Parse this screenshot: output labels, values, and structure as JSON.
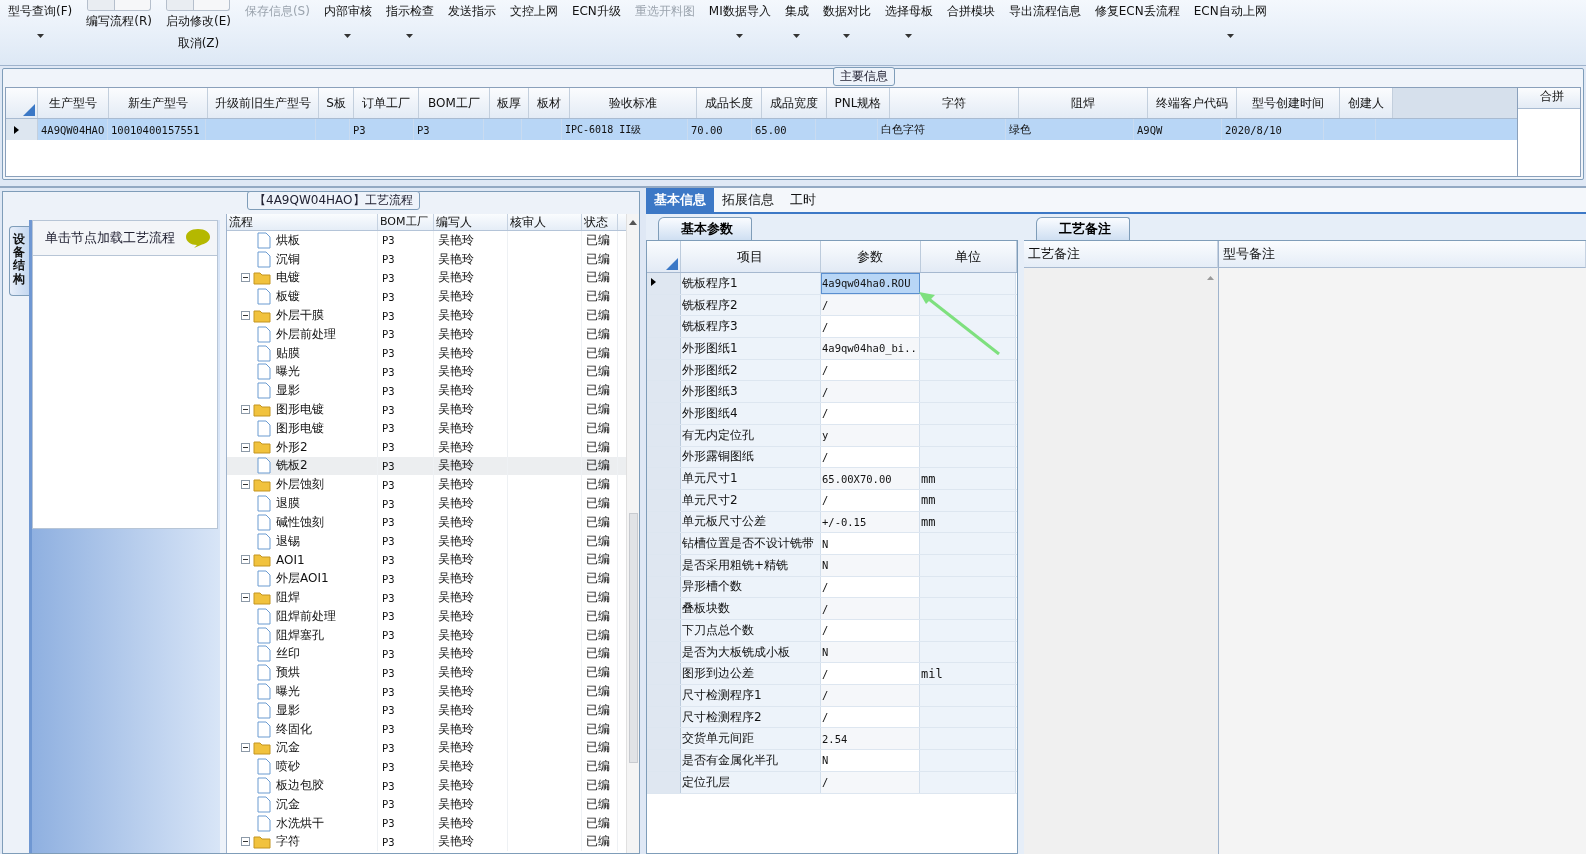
{
  "toolbar": [
    {
      "label": "型号查询(F)",
      "kind": "dropdown",
      "disabled": false
    },
    {
      "label": "编写流程(R)",
      "kind": "toggle",
      "on": false,
      "disabled": false
    },
    {
      "label": "启动修改(E)",
      "kind": "toggle",
      "on": false,
      "second_label": "取消(Z)",
      "disabled": false
    },
    {
      "label": "保存信息(S)",
      "kind": "plain",
      "disabled": true
    },
    {
      "label": "内部审核",
      "kind": "dropdown",
      "disabled": false
    },
    {
      "label": "指示检查",
      "kind": "dropdown",
      "disabled": false
    },
    {
      "label": "发送指示",
      "kind": "plain",
      "disabled": false
    },
    {
      "label": "文控上网",
      "kind": "plain",
      "disabled": false
    },
    {
      "label": "ECN升级",
      "kind": "plain",
      "disabled": false
    },
    {
      "label": "重选开料图",
      "kind": "plain",
      "disabled": true
    },
    {
      "label": "MI数据导入",
      "kind": "dropdown",
      "disabled": false
    },
    {
      "label": "集成",
      "kind": "dropdown",
      "disabled": false
    },
    {
      "label": "数据对比",
      "kind": "dropdown",
      "disabled": false
    },
    {
      "label": "选择母板",
      "kind": "dropdown",
      "disabled": false
    },
    {
      "label": "合拼模块",
      "kind": "plain",
      "disabled": false
    },
    {
      "label": "导出流程信息",
      "kind": "plain",
      "disabled": false
    },
    {
      "label": "修复ECN丢流程",
      "kind": "plain",
      "disabled": false
    },
    {
      "label": "ECN自动上网",
      "kind": "dropdown",
      "disabled": false
    }
  ],
  "main_info": {
    "title": "主要信息",
    "columns": [
      "生产型号",
      "新生产型号",
      "升级前旧生产型号",
      "S板",
      "订单工厂",
      "BOM工厂",
      "板厚",
      "板材",
      "验收标准",
      "成品长度",
      "成品宽度",
      "PNL规格",
      "字符",
      "阻焊",
      "终端客户代码",
      "型号创建时间",
      "创建人"
    ],
    "rows": [
      {
        "selected": true,
        "cells": [
          "4A9QW04HAO",
          "10010400157551",
          "",
          "",
          "P3",
          "P3",
          "",
          "",
          "IPC-6018 II级",
          "70.00",
          "65.00",
          "",
          "白色字符",
          "绿色",
          "A9QW",
          "2020/8/10",
          ""
        ]
      }
    ],
    "side_header": "合拼"
  },
  "flow": {
    "title": "【4A9QW04HAO】工艺流程",
    "side_tab": "设备结构",
    "hint": "单击节点加载工艺流程",
    "columns": [
      "流程",
      "BOM工厂",
      "编写人",
      "核审人",
      "状态"
    ],
    "nodes": [
      {
        "kind": "file",
        "label": "烘板",
        "bom": "P3",
        "writer": "吴艳玲",
        "status": "已编",
        "selected": false
      },
      {
        "kind": "file",
        "label": "沉铜",
        "bom": "P3",
        "writer": "吴艳玲",
        "status": "已编",
        "selected": false
      },
      {
        "kind": "folder",
        "label": "电镀",
        "bom": "P3",
        "writer": "吴艳玲",
        "status": "已编",
        "selected": false,
        "expanded": true,
        "children": [
          {
            "kind": "file",
            "label": "板镀",
            "bom": "P3",
            "writer": "吴艳玲",
            "status": "已编",
            "selected": false
          }
        ]
      },
      {
        "kind": "folder",
        "label": "外层干膜",
        "bom": "P3",
        "writer": "吴艳玲",
        "status": "已编",
        "selected": false,
        "expanded": true,
        "children": [
          {
            "kind": "file",
            "label": "外层前处理",
            "bom": "P3",
            "writer": "吴艳玲",
            "status": "已编",
            "selected": false
          },
          {
            "kind": "file",
            "label": "贴膜",
            "bom": "P3",
            "writer": "吴艳玲",
            "status": "已编",
            "selected": false
          },
          {
            "kind": "file",
            "label": "曝光",
            "bom": "P3",
            "writer": "吴艳玲",
            "status": "已编",
            "selected": false
          },
          {
            "kind": "file",
            "label": "显影",
            "bom": "P3",
            "writer": "吴艳玲",
            "status": "已编",
            "selected": false
          }
        ]
      },
      {
        "kind": "folder",
        "label": "图形电镀",
        "bom": "P3",
        "writer": "吴艳玲",
        "status": "已编",
        "selected": false,
        "expanded": true,
        "children": [
          {
            "kind": "file",
            "label": "图形电镀",
            "bom": "P3",
            "writer": "吴艳玲",
            "status": "已编",
            "selected": false
          }
        ]
      },
      {
        "kind": "folder",
        "label": "外形2",
        "bom": "P3",
        "writer": "吴艳玲",
        "status": "已编",
        "selected": false,
        "expanded": true,
        "children": [
          {
            "kind": "file",
            "label": "铣板2",
            "bom": "P3",
            "writer": "吴艳玲",
            "status": "已编",
            "selected": true
          }
        ]
      },
      {
        "kind": "folder",
        "label": "外层蚀刻",
        "bom": "P3",
        "writer": "吴艳玲",
        "status": "已编",
        "selected": false,
        "expanded": true,
        "children": [
          {
            "kind": "file",
            "label": "退膜",
            "bom": "P3",
            "writer": "吴艳玲",
            "status": "已编",
            "selected": false
          },
          {
            "kind": "file",
            "label": "碱性蚀刻",
            "bom": "P3",
            "writer": "吴艳玲",
            "status": "已编",
            "selected": false
          },
          {
            "kind": "file",
            "label": "退锡",
            "bom": "P3",
            "writer": "吴艳玲",
            "status": "已编",
            "selected": false
          }
        ]
      },
      {
        "kind": "folder",
        "label": "AOI1",
        "bom": "P3",
        "writer": "吴艳玲",
        "status": "已编",
        "selected": false,
        "expanded": true,
        "children": [
          {
            "kind": "file",
            "label": "外层AOI1",
            "bom": "P3",
            "writer": "吴艳玲",
            "status": "已编",
            "selected": false
          }
        ]
      },
      {
        "kind": "folder",
        "label": "阻焊",
        "bom": "P3",
        "writer": "吴艳玲",
        "status": "已编",
        "selected": false,
        "expanded": true,
        "children": [
          {
            "kind": "file",
            "label": "阻焊前处理",
            "bom": "P3",
            "writer": "吴艳玲",
            "status": "已编",
            "selected": false
          },
          {
            "kind": "file",
            "label": "阻焊塞孔",
            "bom": "P3",
            "writer": "吴艳玲",
            "status": "已编",
            "selected": false
          },
          {
            "kind": "file",
            "label": "丝印",
            "bom": "P3",
            "writer": "吴艳玲",
            "status": "已编",
            "selected": false
          },
          {
            "kind": "file",
            "label": "预烘",
            "bom": "P3",
            "writer": "吴艳玲",
            "status": "已编",
            "selected": false
          },
          {
            "kind": "file",
            "label": "曝光",
            "bom": "P3",
            "writer": "吴艳玲",
            "status": "已编",
            "selected": false
          },
          {
            "kind": "file",
            "label": "显影",
            "bom": "P3",
            "writer": "吴艳玲",
            "status": "已编",
            "selected": false
          },
          {
            "kind": "file",
            "label": "终固化",
            "bom": "P3",
            "writer": "吴艳玲",
            "status": "已编",
            "selected": false
          }
        ]
      },
      {
        "kind": "folder",
        "label": "沉金",
        "bom": "P3",
        "writer": "吴艳玲",
        "status": "已编",
        "selected": false,
        "expanded": true,
        "children": [
          {
            "kind": "file",
            "label": "喷砂",
            "bom": "P3",
            "writer": "吴艳玲",
            "status": "已编",
            "selected": false
          },
          {
            "kind": "file",
            "label": "板边包胶",
            "bom": "P3",
            "writer": "吴艳玲",
            "status": "已编",
            "selected": false
          },
          {
            "kind": "file",
            "label": "沉金",
            "bom": "P3",
            "writer": "吴艳玲",
            "status": "已编",
            "selected": false
          },
          {
            "kind": "file",
            "label": "水洗烘干",
            "bom": "P3",
            "writer": "吴艳玲",
            "status": "已编",
            "selected": false
          }
        ]
      },
      {
        "kind": "folder",
        "label": "字符",
        "bom": "P3",
        "writer": "吴艳玲",
        "status": "已编",
        "selected": false,
        "expanded": true
      }
    ]
  },
  "tabs": [
    {
      "label": "基本信息",
      "selected": true
    },
    {
      "label": "拓展信息",
      "selected": false
    },
    {
      "label": "工时",
      "selected": false
    }
  ],
  "params": {
    "tab": "基本参数",
    "columns": [
      "项目",
      "参数",
      "单位"
    ],
    "rows": [
      {
        "item": "铣板程序1",
        "value": "4a9qw04ha0.ROU",
        "unit": "",
        "selected": true
      },
      {
        "item": "铣板程序2",
        "value": "/",
        "unit": "",
        "selected": false
      },
      {
        "item": "铣板程序3",
        "value": "/",
        "unit": "",
        "selected": false
      },
      {
        "item": "外形图纸1",
        "value": "4a9qw04ha0_bi...",
        "unit": "",
        "selected": false
      },
      {
        "item": "外形图纸2",
        "value": "/",
        "unit": "",
        "selected": false
      },
      {
        "item": "外形图纸3",
        "value": "/",
        "unit": "",
        "selected": false
      },
      {
        "item": "外形图纸4",
        "value": "/",
        "unit": "",
        "selected": false
      },
      {
        "item": "有无内定位孔",
        "value": "y",
        "unit": "",
        "selected": false
      },
      {
        "item": "外形露铜图纸",
        "value": "/",
        "unit": "",
        "selected": false
      },
      {
        "item": "单元尺寸1",
        "value": "65.00X70.00",
        "unit": "mm",
        "selected": false
      },
      {
        "item": "单元尺寸2",
        "value": "/",
        "unit": "mm",
        "selected": false
      },
      {
        "item": "单元板尺寸公差",
        "value": "+/-0.15",
        "unit": "mm",
        "selected": false
      },
      {
        "item": "钻槽位置是否不设计铣带",
        "value": "N",
        "unit": "",
        "selected": false
      },
      {
        "item": "是否采用粗铣+精铣",
        "value": "N",
        "unit": "",
        "selected": false
      },
      {
        "item": "异形槽个数",
        "value": "/",
        "unit": "",
        "selected": false
      },
      {
        "item": "叠板块数",
        "value": "/",
        "unit": "",
        "selected": false
      },
      {
        "item": "下刀点总个数",
        "value": "/",
        "unit": "",
        "selected": false
      },
      {
        "item": "是否为大板铣成小板",
        "value": "N",
        "unit": "",
        "selected": false
      },
      {
        "item": "图形到边公差",
        "value": "/",
        "unit": "mil",
        "selected": false
      },
      {
        "item": "尺寸检测程序1",
        "value": "/",
        "unit": "",
        "selected": false
      },
      {
        "item": "尺寸检测程序2",
        "value": "/",
        "unit": "",
        "selected": false
      },
      {
        "item": "交货单元间距",
        "value": "2.54",
        "unit": "",
        "selected": false
      },
      {
        "item": "是否有金属化半孔",
        "value": "N",
        "unit": "",
        "selected": false
      },
      {
        "item": "定位孔层",
        "value": "/",
        "unit": "",
        "selected": false
      }
    ]
  },
  "remarks": {
    "tab": "工艺备注",
    "columns": [
      "工艺备注",
      "型号备注"
    ]
  }
}
